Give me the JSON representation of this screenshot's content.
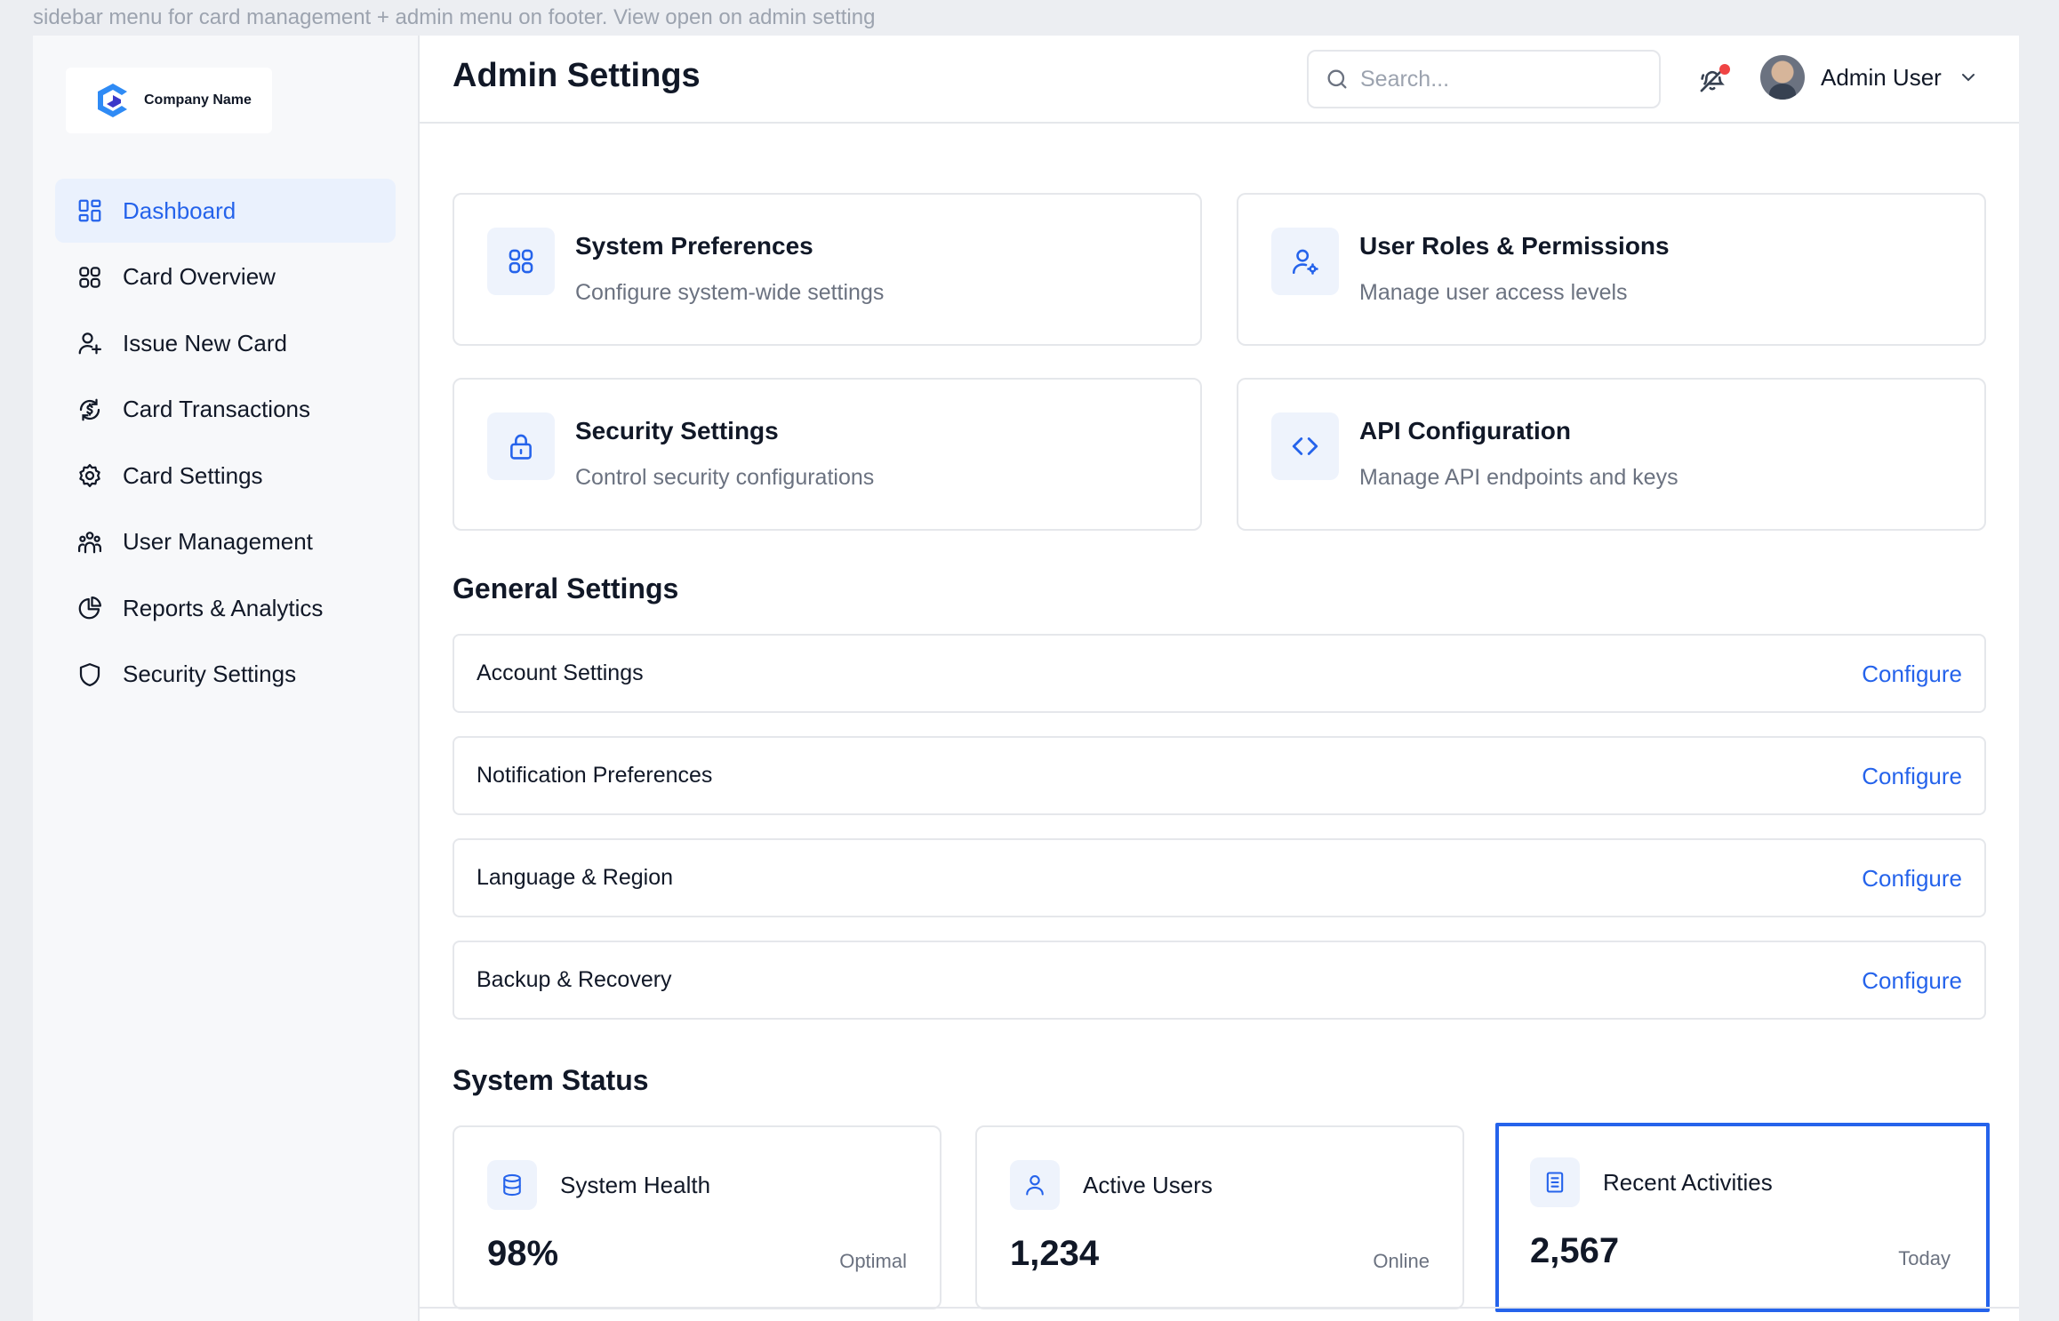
{
  "caption": "sidebar menu for card management + admin menu on footer. View open on admin setting",
  "brand": {
    "name": "Company Name"
  },
  "sidebar": {
    "items": [
      {
        "label": "Dashboard",
        "icon": "dashboard-icon",
        "active": true
      },
      {
        "label": "Card Overview",
        "icon": "grid-icon"
      },
      {
        "label": "Issue New Card",
        "icon": "user-plus-icon"
      },
      {
        "label": "Card Transactions",
        "icon": "dollar-cycle-icon"
      },
      {
        "label": "Card Settings",
        "icon": "gear-icon"
      },
      {
        "label": "User Management",
        "icon": "users-icon"
      },
      {
        "label": "Reports & Analytics",
        "icon": "pie-chart-icon"
      },
      {
        "label": "Security Settings",
        "icon": "shield-icon"
      }
    ]
  },
  "header": {
    "title": "Admin Settings",
    "search_placeholder": "Search...",
    "user_name": "Admin User"
  },
  "cards": [
    {
      "title": "System Preferences",
      "desc": "Configure system-wide settings",
      "icon": "grid-icon"
    },
    {
      "title": "User Roles & Permissions",
      "desc": "Manage user access levels",
      "icon": "user-gear-icon"
    },
    {
      "title": "Security Settings",
      "desc": "Control security configurations",
      "icon": "lock-icon"
    },
    {
      "title": "API Configuration",
      "desc": "Manage API endpoints and keys",
      "icon": "code-icon"
    }
  ],
  "general": {
    "title": "General Settings",
    "configure_label": "Configure",
    "rows": [
      {
        "label": "Account Settings"
      },
      {
        "label": "Notification Preferences"
      },
      {
        "label": "Language & Region"
      },
      {
        "label": "Backup & Recovery"
      }
    ]
  },
  "status": {
    "title": "System Status",
    "items": [
      {
        "title": "System Health",
        "value": "98%",
        "sub": "Optimal",
        "icon": "database-icon"
      },
      {
        "title": "Active Users",
        "value": "1,234",
        "sub": "Online",
        "icon": "user-icon"
      },
      {
        "title": "Recent Activities",
        "value": "2,567",
        "sub": "Today",
        "icon": "document-icon",
        "selected": true
      }
    ]
  },
  "colors": {
    "accent": "#2563eb",
    "active_bg": "#eaf1fd",
    "icon_bg": "#eef3fc",
    "notification": "#ef4444"
  }
}
